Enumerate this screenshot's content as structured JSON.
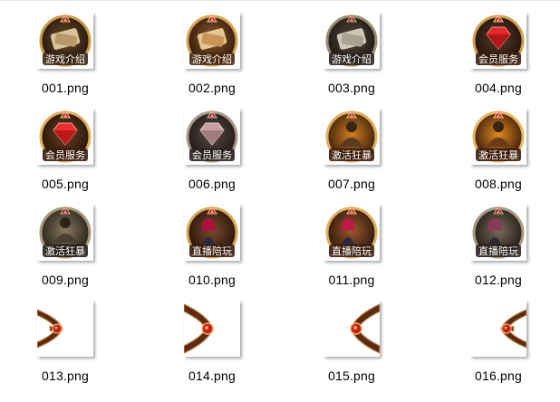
{
  "files": [
    {
      "name": "001.png",
      "kind": "badge",
      "icon": "scroll-icon",
      "badge_label": "游戏介绍",
      "level": "1"
    },
    {
      "name": "002.png",
      "kind": "badge",
      "icon": "scroll-icon",
      "badge_label": "游戏介绍",
      "level": "1"
    },
    {
      "name": "003.png",
      "kind": "badge",
      "icon": "scroll-icon",
      "badge_label": "游戏介绍",
      "level": "1"
    },
    {
      "name": "004.png",
      "kind": "badge",
      "icon": "gem-icon",
      "badge_label": "会员服务",
      "level": "1"
    },
    {
      "name": "005.png",
      "kind": "badge",
      "icon": "gem-icon",
      "badge_label": "会员服务",
      "level": "1"
    },
    {
      "name": "006.png",
      "kind": "badge",
      "icon": "gem-icon",
      "badge_label": "会员服务",
      "level": "1"
    },
    {
      "name": "007.png",
      "kind": "badge",
      "icon": "warrior-icon",
      "badge_label": "激活狂暴",
      "level": "1"
    },
    {
      "name": "008.png",
      "kind": "badge",
      "icon": "warrior-icon",
      "badge_label": "激活狂暴",
      "level": "1"
    },
    {
      "name": "009.png",
      "kind": "badge",
      "icon": "warrior-icon",
      "badge_label": "激活狂暴",
      "level": "1"
    },
    {
      "name": "010.png",
      "kind": "badge",
      "icon": "streamer-girl-icon",
      "badge_label": "直播陪玩",
      "level": "1"
    },
    {
      "name": "011.png",
      "kind": "badge",
      "icon": "streamer-girl-icon",
      "badge_label": "直播陪玩",
      "level": "1"
    },
    {
      "name": "012.png",
      "kind": "badge",
      "icon": "streamer-girl-icon",
      "badge_label": "直播陪玩",
      "level": "1"
    },
    {
      "name": "013.png",
      "kind": "frame",
      "icon": "frame-corner-left-icon"
    },
    {
      "name": "014.png",
      "kind": "frame",
      "icon": "frame-corner-left-icon"
    },
    {
      "name": "015.png",
      "kind": "frame",
      "icon": "frame-corner-right-icon"
    },
    {
      "name": "016.png",
      "kind": "frame",
      "icon": "frame-corner-right-icon"
    }
  ]
}
